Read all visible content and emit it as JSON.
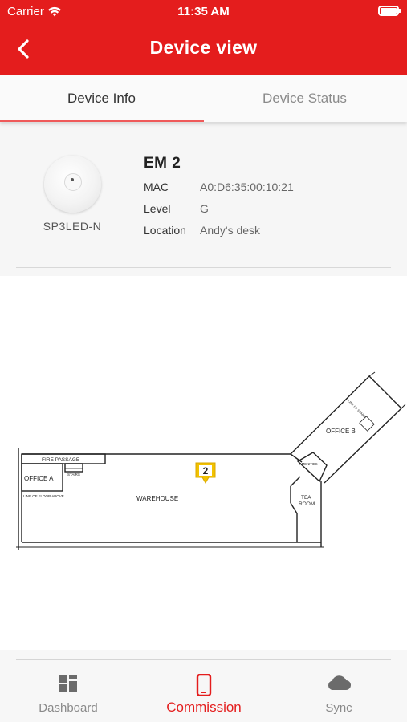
{
  "status_bar": {
    "carrier": "Carrier",
    "time": "11:35 AM",
    "battery_level": 1.0
  },
  "nav": {
    "back_icon": "chevron-left-icon",
    "title": "Device view"
  },
  "tabs": [
    {
      "label": "Device Info",
      "active": true
    },
    {
      "label": "Device Status",
      "active": false
    }
  ],
  "device": {
    "model": "SP3LED-N",
    "name": "EM 2",
    "fields": [
      {
        "label": "MAC",
        "value": "A0:D6:35:00:10:21"
      },
      {
        "label": "Level",
        "value": "G"
      },
      {
        "label": "Location",
        "value": "Andy's desk"
      }
    ]
  },
  "floor_plan": {
    "rooms": {
      "fire_passage": "FIRE PASSAGE",
      "office_a": "OFFICE A",
      "stairs": "STAIRS",
      "line_of_floor": "LINE OF FLOOR ABOVE",
      "warehouse": "WAREHOUSE",
      "amenities": "AMENITIES",
      "tea_room": "TEA",
      "tea_room_2": "ROOM",
      "office_b": "OFFICE B",
      "office_b_note": "LINE OF STAIRS"
    },
    "marker": {
      "label": "2",
      "color": "#f2c200"
    }
  },
  "bottom_tabs": [
    {
      "label": "Dashboard",
      "icon": "dashboard-grid-icon",
      "active": false
    },
    {
      "label": "Commission",
      "icon": "phone-icon",
      "active": true
    },
    {
      "label": "Sync",
      "icon": "cloud-icon",
      "active": false
    }
  ],
  "colors": {
    "accent": "#e41d1d",
    "tab_indicator": "#ef5a5a",
    "marker": "#f2c200"
  }
}
